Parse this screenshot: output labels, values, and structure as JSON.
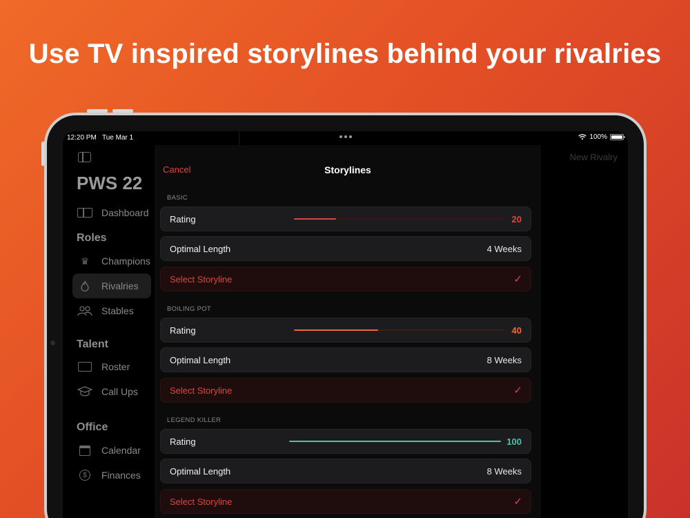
{
  "headline": "Use TV inspired storylines behind your rivalries",
  "status": {
    "time": "12:20 PM",
    "date": "Tue Mar 1",
    "battery": "100%"
  },
  "sidebar": {
    "title": "PWS 22",
    "dashboard": "Dashboard",
    "sections": {
      "roles": "Roles",
      "talent": "Talent",
      "office": "Office"
    },
    "items": {
      "champions": "Champions",
      "rivalries": "Rivalries",
      "stables": "Stables",
      "roster": "Roster",
      "callups": "Call Ups",
      "calendar": "Calendar",
      "finances": "Finances"
    }
  },
  "right_title": "New Rivalry",
  "sheet": {
    "cancel": "Cancel",
    "title": "Storylines",
    "groups": [
      {
        "label": "BASIC",
        "rating_label": "Rating",
        "rating": "20",
        "rating_fraction": 0.2,
        "color": "#e0453b",
        "track": "#3a1414",
        "length_label": "Optimal Length",
        "length": "4 Weeks",
        "select_label": "Select Storyline",
        "check": "✓"
      },
      {
        "label": "BOILING POT",
        "rating_label": "Rating",
        "rating": "40",
        "rating_fraction": 0.4,
        "color": "#ec6a3a",
        "track": "#3a1e14",
        "length_label": "Optimal Length",
        "length": "8 Weeks",
        "select_label": "Select Storyline",
        "check": "✓"
      },
      {
        "label": "LEGEND KILLER",
        "rating_label": "Rating",
        "rating": "100",
        "rating_fraction": 1.0,
        "color": "#4fc2ad",
        "track": "#163a34",
        "length_label": "Optimal Length",
        "length": "8 Weeks",
        "select_label": "Select Storyline",
        "check": "✓"
      }
    ]
  }
}
